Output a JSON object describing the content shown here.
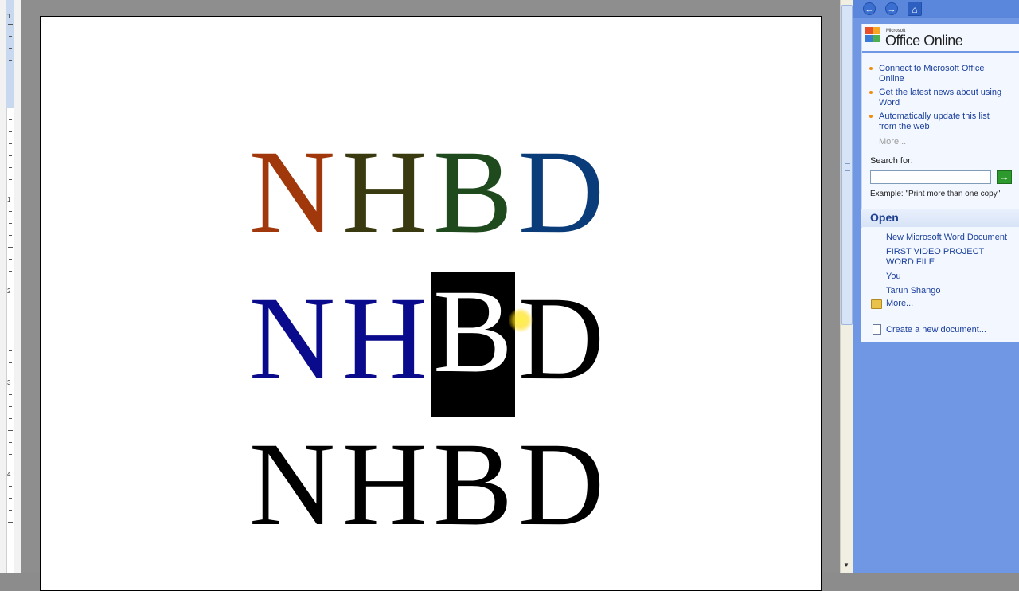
{
  "ruler": {
    "numbers": [
      "1",
      "1",
      "2",
      "3",
      "4"
    ]
  },
  "document": {
    "rows": [
      {
        "letters": [
          "N",
          "H",
          "B",
          "D"
        ],
        "colors": [
          "#a0380c",
          "#3a3a10",
          "#1e4a1e",
          "#0b3c7a"
        ]
      },
      {
        "letters": [
          "N",
          "H",
          "B",
          "D"
        ],
        "colors": [
          "#0a0a8c",
          "#0a0a8c",
          "#ffffff",
          "#000000"
        ],
        "selected_index": 2
      },
      {
        "letters": [
          "N",
          "H",
          "B",
          "D"
        ],
        "colors": [
          "#000000",
          "#000000",
          "#000000",
          "#000000"
        ]
      }
    ]
  },
  "taskpane": {
    "nav": {
      "back": "←",
      "forward": "→",
      "home": "⌂"
    },
    "logo": {
      "microsoft": "Microsoft",
      "office_online": "Office Online"
    },
    "links": [
      "Connect to Microsoft Office Online",
      "Get the latest news about using Word",
      "Automatically update this list from the web"
    ],
    "more": "More...",
    "search_label": "Search for:",
    "search_value": "",
    "search_go": "→",
    "search_example": "Example:  \"Print more than one copy\"",
    "open_title": "Open",
    "open_docs": [
      "New Microsoft Word Document",
      "FIRST VIDEO PROJECT WORD FILE",
      "You",
      "Tarun Shango"
    ],
    "open_more": "More...",
    "create_new": "Create a new document..."
  },
  "colors": {
    "accent_orange": "#f08c10",
    "taskpane_blue": "#6f97e4",
    "link_blue": "#1a3f9c"
  }
}
